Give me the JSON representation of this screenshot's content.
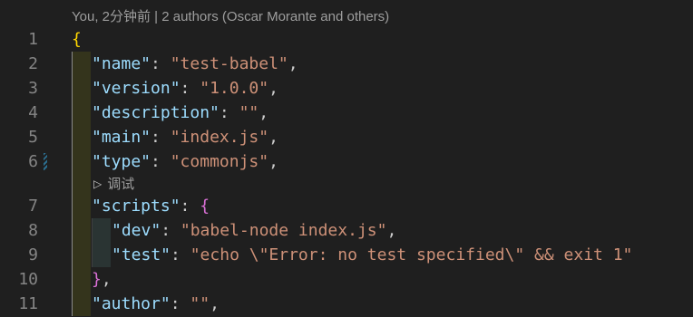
{
  "blame": "You, 2分钟前 | 2 authors (Oscar Morante and others)",
  "run_lens": {
    "label": "调试",
    "icon": "play-icon"
  },
  "lines": [
    {
      "n": "1",
      "open_brace": "{"
    },
    {
      "n": "2",
      "key": "\"name\"",
      "sep": ": ",
      "value": "\"test-babel\"",
      "end": ","
    },
    {
      "n": "3",
      "key": "\"version\"",
      "sep": ": ",
      "value": "\"1.0.0\"",
      "end": ","
    },
    {
      "n": "4",
      "key": "\"description\"",
      "sep": ": ",
      "value": "\"\"",
      "end": ","
    },
    {
      "n": "5",
      "key": "\"main\"",
      "sep": ": ",
      "value": "\"index.js\"",
      "end": ","
    },
    {
      "n": "6",
      "key": "\"type\"",
      "sep": ": ",
      "value": "\"commonjs\"",
      "end": ","
    },
    {
      "n": "7",
      "key": "\"scripts\"",
      "sep": ": ",
      "brace": "{"
    },
    {
      "n": "8",
      "key": "\"dev\"",
      "sep": ": ",
      "value": "\"babel-node index.js\"",
      "end": ","
    },
    {
      "n": "9",
      "key": "\"test\"",
      "sep": ": ",
      "value": "\"echo \\\"Error: no test specified\\\" && exit 1\""
    },
    {
      "n": "10",
      "close_brace": "}",
      "end": ","
    },
    {
      "n": "11",
      "key": "\"author\"",
      "sep": ": ",
      "value": "\"\"",
      "end": ","
    }
  ]
}
